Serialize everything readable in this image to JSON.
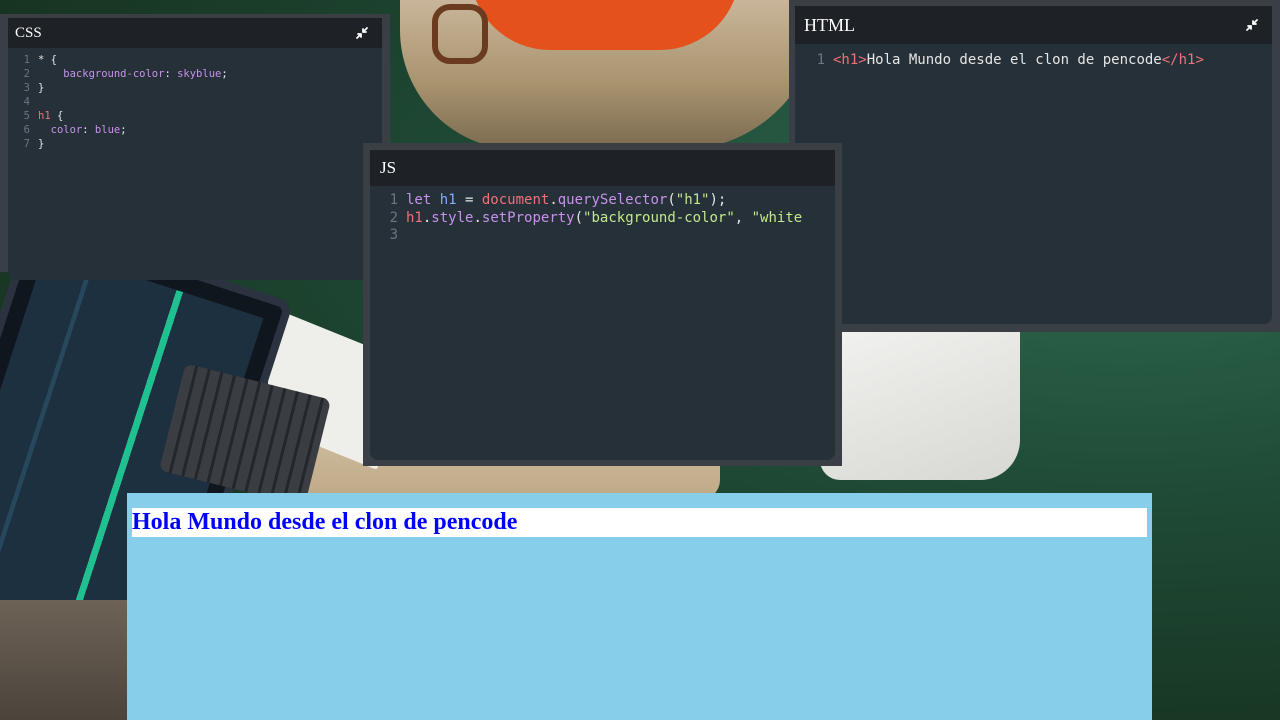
{
  "panels": {
    "css": {
      "title": "CSS"
    },
    "js": {
      "title": "JS"
    },
    "html": {
      "title": "HTML"
    }
  },
  "code": {
    "css": [
      {
        "n": "1",
        "parts": [
          {
            "t": "* {",
            "c": ""
          }
        ]
      },
      {
        "n": "2",
        "parts": [
          {
            "t": "    background-color",
            "c": "prop"
          },
          {
            "t": ": ",
            "c": ""
          },
          {
            "t": "skyblue",
            "c": "kw"
          },
          {
            "t": ";",
            "c": ""
          }
        ]
      },
      {
        "n": "3",
        "parts": [
          {
            "t": "}",
            "c": ""
          }
        ]
      },
      {
        "n": "4",
        "parts": []
      },
      {
        "n": "5",
        "parts": [
          {
            "t": "h1",
            "c": "tg"
          },
          {
            "t": " {",
            "c": ""
          }
        ]
      },
      {
        "n": "6",
        "parts": [
          {
            "t": "  color",
            "c": "prop"
          },
          {
            "t": ": ",
            "c": ""
          },
          {
            "t": "blue",
            "c": "kw"
          },
          {
            "t": ";",
            "c": ""
          }
        ]
      },
      {
        "n": "7",
        "parts": [
          {
            "t": "}",
            "c": ""
          }
        ]
      }
    ],
    "js": [
      {
        "n": "1",
        "parts": [
          {
            "t": "let ",
            "c": "kw"
          },
          {
            "t": "h1",
            "c": "vr"
          },
          {
            "t": " = ",
            "c": ""
          },
          {
            "t": "document",
            "c": "ob"
          },
          {
            "t": ".",
            "c": ""
          },
          {
            "t": "querySelector",
            "c": "fn"
          },
          {
            "t": "(",
            "c": ""
          },
          {
            "t": "\"h1\"",
            "c": "st"
          },
          {
            "t": ");",
            "c": ""
          }
        ]
      },
      {
        "n": "2",
        "parts": [
          {
            "t": "h1",
            "c": "ob"
          },
          {
            "t": ".",
            "c": ""
          },
          {
            "t": "style",
            "c": "fn"
          },
          {
            "t": ".",
            "c": ""
          },
          {
            "t": "setProperty",
            "c": "fn"
          },
          {
            "t": "(",
            "c": ""
          },
          {
            "t": "\"background-color\"",
            "c": "st"
          },
          {
            "t": ", ",
            "c": ""
          },
          {
            "t": "\"white",
            "c": "st"
          }
        ]
      },
      {
        "n": "3",
        "parts": []
      }
    ],
    "html": [
      {
        "n": "1",
        "parts": [
          {
            "t": "<h1>",
            "c": "tg"
          },
          {
            "t": "Hola Mundo desde el clon de pencode",
            "c": ""
          },
          {
            "t": "</h1>",
            "c": "tg"
          }
        ]
      }
    ]
  },
  "preview": {
    "heading": "Hola Mundo desde el clon de pencode"
  },
  "icons": {
    "minimize": "minimize-icon"
  },
  "colors": {
    "preview_bg": "#87ceeb",
    "heading_color": "#0000ff",
    "editor_bg": "#263038",
    "header_bg": "#1e2126"
  }
}
